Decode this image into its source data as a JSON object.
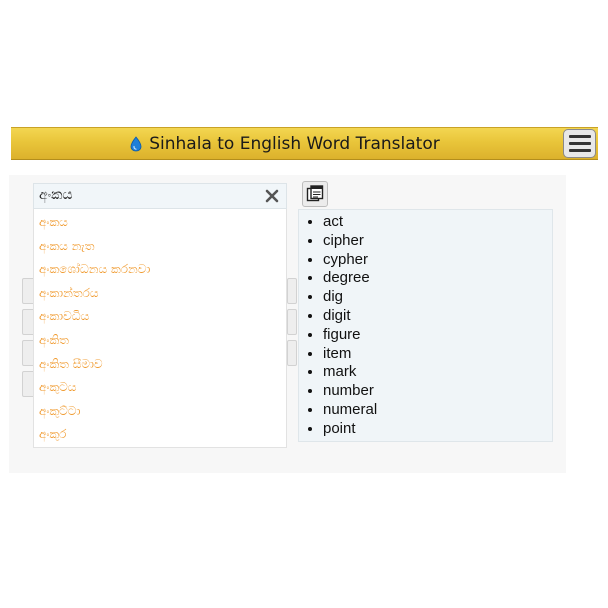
{
  "header": {
    "title": "Sinhala to English Word Translator",
    "icon": "water-drop-icon",
    "menu_icon": "hamburger-menu-icon",
    "bar_color": "#e9c53a"
  },
  "search": {
    "value": "අංකය",
    "clear_icon": "close-icon"
  },
  "suggestions": [
    "අංකය",
    "අංකය නැත",
    "අංකශෝධනය කරනවා",
    "අංකාන්තරය",
    "අංකාවධිය",
    "අංකිත",
    "අංකිත සීමාව",
    "අංකුටය",
    "අංකුට්ටා",
    "අංකුර"
  ],
  "copy_icon": "copy-clipboard-icon",
  "results": [
    "act",
    "cipher",
    "cypher",
    "degree",
    "dig",
    "digit",
    "figure",
    "item",
    "mark",
    "number",
    "numeral",
    "point"
  ],
  "colors": {
    "suggestion_text": "#f09a2e",
    "results_background": "#f0f5f8"
  }
}
